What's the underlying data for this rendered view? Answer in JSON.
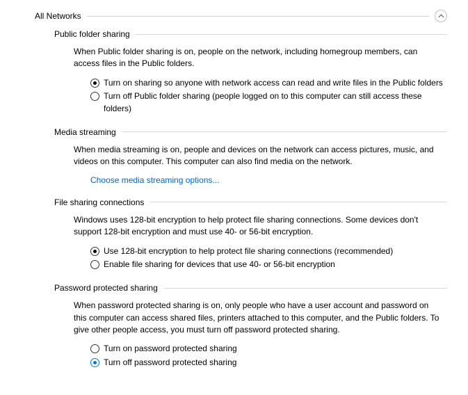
{
  "group_title": "All Networks",
  "sections": {
    "public_folder": {
      "title": "Public folder sharing",
      "desc": "When Public folder sharing is on, people on the network, including homegroup members, can access files in the Public folders.",
      "opt_on": "Turn on sharing so anyone with network access can read and write files in the Public folders",
      "opt_off": "Turn off Public folder sharing (people logged on to this computer can still access these folders)"
    },
    "media": {
      "title": "Media streaming",
      "desc": "When media streaming is on, people and devices on the network can access pictures, music, and videos on this computer. This computer can also find media on the network.",
      "link": "Choose media streaming options..."
    },
    "file_sharing": {
      "title": "File sharing connections",
      "desc": "Windows uses 128-bit encryption to help protect file sharing connections. Some devices don't support 128-bit encryption and must use 40- or 56-bit encryption.",
      "opt_128": "Use 128-bit encryption to help protect file sharing connections (recommended)",
      "opt_40": "Enable file sharing for devices that use 40- or 56-bit encryption"
    },
    "password": {
      "title": "Password protected sharing",
      "desc": "When password protected sharing is on, only people who have a user account and password on this computer can access shared files, printers attached to this computer, and the Public folders. To give other people access, you must turn off password protected sharing.",
      "opt_on": "Turn on password protected sharing",
      "opt_off": "Turn off password protected sharing"
    }
  }
}
